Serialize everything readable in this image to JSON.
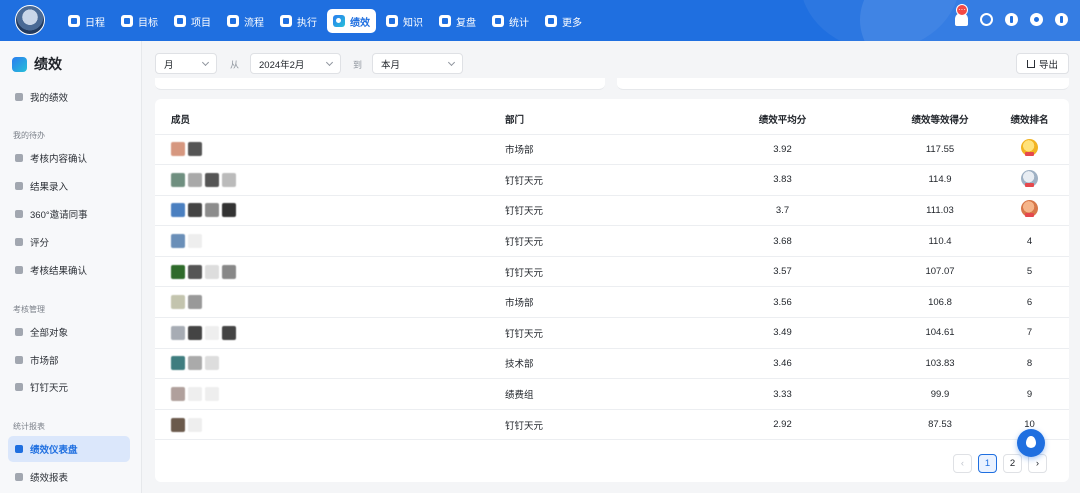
{
  "nav": {
    "items": [
      {
        "label": "日程",
        "icon": "calendar-icon"
      },
      {
        "label": "目标",
        "icon": "target-icon"
      },
      {
        "label": "项目",
        "icon": "cube-icon"
      },
      {
        "label": "流程",
        "icon": "flow-icon"
      },
      {
        "label": "执行",
        "icon": "execute-icon"
      },
      {
        "label": "绩效",
        "icon": "performance-icon",
        "active": true
      },
      {
        "label": "知识",
        "icon": "book-icon"
      },
      {
        "label": "复盘",
        "icon": "review-icon"
      },
      {
        "label": "统计",
        "icon": "pie-icon"
      },
      {
        "label": "更多",
        "icon": "grid-icon"
      }
    ],
    "notification_badge": "···"
  },
  "sidebar": {
    "title": "绩效",
    "my_performance": "我的绩效",
    "todo_group": "我的待办",
    "todo_items": [
      "考核内容确认",
      "结果录入",
      "360°邀请同事",
      "评分",
      "考核结果确认"
    ],
    "manage_group": "考核管理",
    "manage_items": [
      "全部对象",
      "市场部",
      "钉钉天元"
    ],
    "report_group": "统计报表",
    "report_items": [
      "绩效仪表盘",
      "绩效报表"
    ]
  },
  "toolbar": {
    "period": "月",
    "from_label": "从",
    "from_value": "2024年2月",
    "to_label": "到",
    "to_value": "本月",
    "export": "导出"
  },
  "table": {
    "headers": [
      "成员",
      "部门",
      "绩效平均分",
      "绩效等效得分",
      "绩效排名"
    ],
    "rows": [
      {
        "dept": "市场部",
        "avg": "3.92",
        "score": "117.55",
        "rank": "1",
        "medal": "gold",
        "colors": [
          "#d6977f",
          "#555555"
        ]
      },
      {
        "dept": "钉钉天元",
        "avg": "3.83",
        "score": "114.9",
        "rank": "2",
        "medal": "silver",
        "colors": [
          "#6f8f80",
          "#a9a9a9",
          "#555555",
          "#bbbbbb"
        ]
      },
      {
        "dept": "钉钉天元",
        "avg": "3.7",
        "score": "111.03",
        "rank": "3",
        "medal": "bronze",
        "colors": [
          "#4a7fc0",
          "#444444",
          "#8c8c8c",
          "#333333"
        ]
      },
      {
        "dept": "钉钉天元",
        "avg": "3.68",
        "score": "110.4",
        "rank": "4",
        "colors": [
          "#6a8fb8",
          "#eeeeee"
        ]
      },
      {
        "dept": "钉钉天元",
        "avg": "3.57",
        "score": "107.07",
        "rank": "5",
        "colors": [
          "#2f6b2b",
          "#555555",
          "#dddddd",
          "#888888"
        ]
      },
      {
        "dept": "市场部",
        "avg": "3.56",
        "score": "106.8",
        "rank": "6",
        "colors": [
          "#c3c4ae",
          "#999999"
        ]
      },
      {
        "dept": "钉钉天元",
        "avg": "3.49",
        "score": "104.61",
        "rank": "7",
        "colors": [
          "#a7acb4",
          "#444444",
          "#eeeeee",
          "#444444"
        ]
      },
      {
        "dept": "技术部",
        "avg": "3.46",
        "score": "103.83",
        "rank": "8",
        "colors": [
          "#3f7d7f",
          "#aaaaaa",
          "#dddddd"
        ]
      },
      {
        "dept": "绩费组",
        "avg": "3.33",
        "score": "99.9",
        "rank": "9",
        "colors": [
          "#b0a09c",
          "#eeeeee",
          "#eeeeee"
        ]
      },
      {
        "dept": "钉钉天元",
        "avg": "2.92",
        "score": "87.53",
        "rank": "10",
        "colors": [
          "#6b5a4c",
          "#eeeeee"
        ]
      }
    ]
  },
  "pagination": {
    "pages": [
      "1",
      "2"
    ],
    "current": "1",
    "prev": "‹",
    "next": "›"
  }
}
